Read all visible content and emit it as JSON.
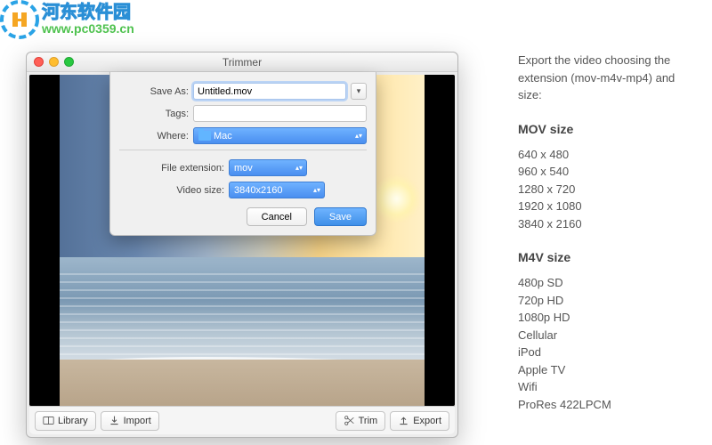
{
  "watermark": {
    "cn": "河东软件园",
    "url": "www.pc0359.cn"
  },
  "window": {
    "title": "Trimmer"
  },
  "sheet": {
    "saveAsLabel": "Save As:",
    "saveAsValue": "Untitled.mov",
    "tagsLabel": "Tags:",
    "tagsValue": "",
    "whereLabel": "Where:",
    "whereValue": "Mac",
    "fileExtLabel": "File extension:",
    "fileExtValue": "mov",
    "videoSizeLabel": "Video size:",
    "videoSizeValue": "3840x2160",
    "cancel": "Cancel",
    "save": "Save"
  },
  "toolbar": {
    "library": "Library",
    "import": "Import",
    "trim": "Trim",
    "export": "Export"
  },
  "doc": {
    "intro": "Export the video choosing the extension (mov-m4v-mp4) and size:",
    "movHeading": "MOV size",
    "movSizes": [
      "640 x 480",
      "960 x 540",
      "1280 x 720",
      "1920 x 1080",
      "3840 x 2160"
    ],
    "m4vHeading": "M4V size",
    "m4vSizes": [
      "480p SD",
      "720p HD",
      "1080p HD",
      "Cellular",
      "iPod",
      "Apple TV",
      "Wifi",
      "ProRes 422LPCM"
    ]
  }
}
